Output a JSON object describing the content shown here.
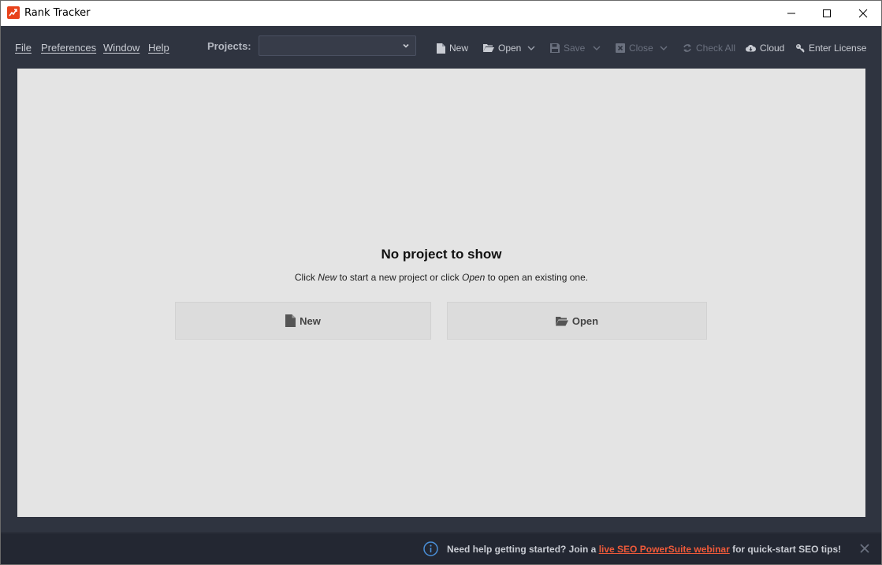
{
  "window": {
    "title": "Rank Tracker"
  },
  "menu": {
    "file": "File",
    "preferences": "Preferences",
    "window": "Window",
    "help": "Help"
  },
  "projects": {
    "label": "Projects:",
    "selected": ""
  },
  "toolbar": {
    "new": "New",
    "open": "Open",
    "save": "Save",
    "close": "Close",
    "check_all": "Check All",
    "cloud": "Cloud",
    "enter_license": "Enter License"
  },
  "empty_state": {
    "title": "No project to show",
    "sub_prefix": "Click ",
    "sub_new": "New",
    "sub_mid": " to start a new project or click ",
    "sub_open": "Open",
    "sub_suffix": " to open an existing one.",
    "new_button": "New",
    "open_button": "Open"
  },
  "footer": {
    "prefix": "Need help getting started? Join a ",
    "link": "live SEO PowerSuite webinar",
    "suffix": " for quick-start SEO tips!"
  },
  "colors": {
    "toolbar_bg": "#2f3440",
    "content_bg": "#e4e4e4",
    "footer_bg": "#232732",
    "accent": "#e8421b",
    "link": "#f05a3a",
    "info_icon": "#4a90d9"
  },
  "icons": {
    "app": "rank-tracker-logo",
    "new": "document-icon",
    "open": "folder-open-icon",
    "save": "floppy-icon",
    "close": "close-box-icon",
    "check_all": "refresh-icon",
    "cloud": "cloud-icon",
    "license": "key-icon",
    "info": "info-icon"
  }
}
